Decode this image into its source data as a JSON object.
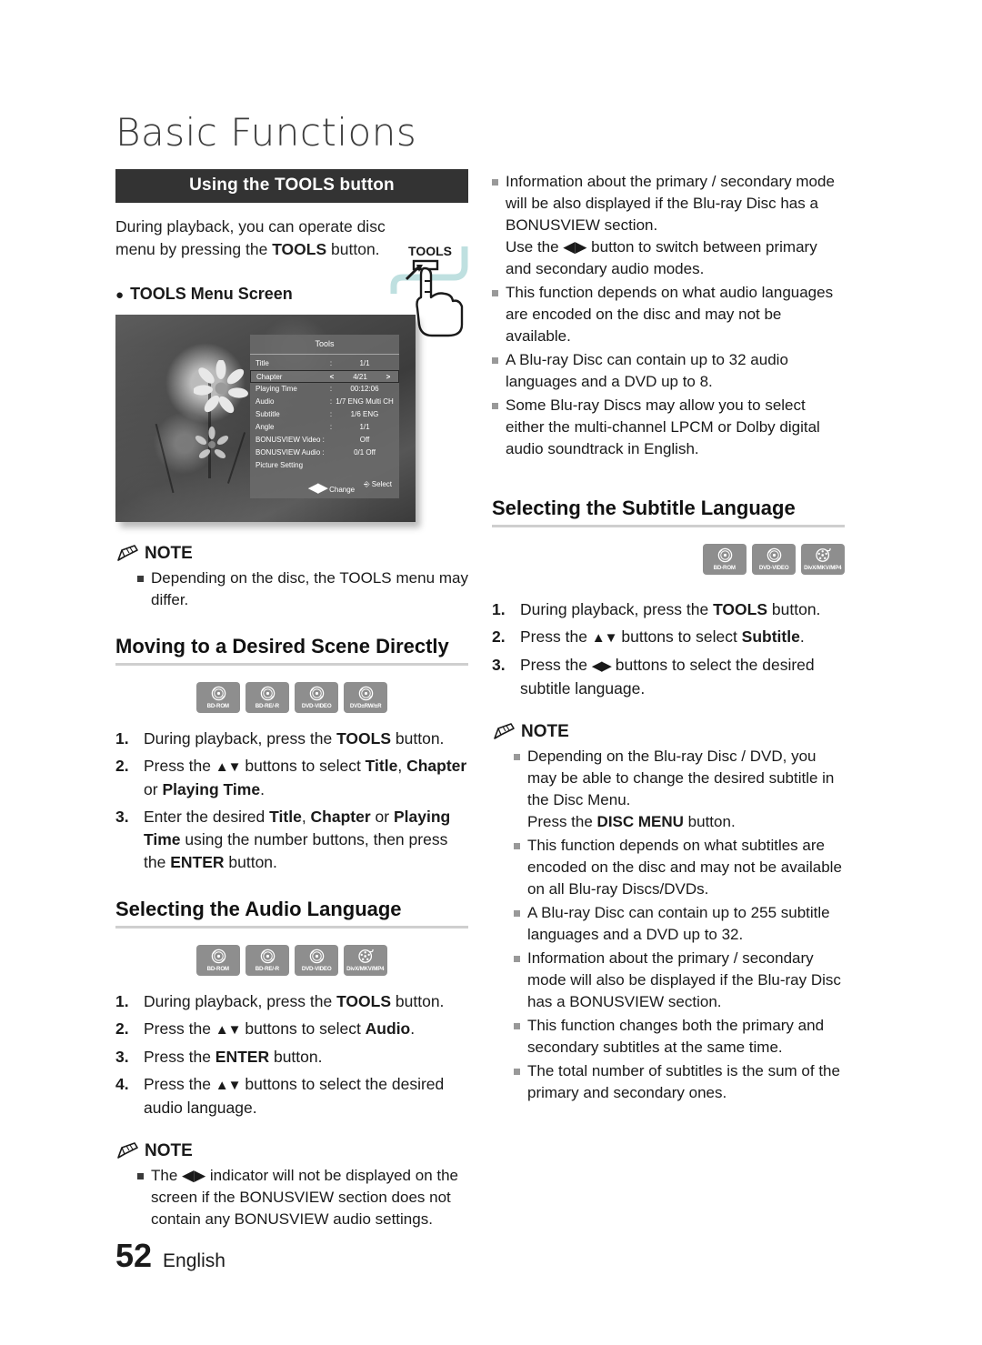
{
  "document": {
    "chapter_title": "Basic Functions",
    "page_number": "52",
    "language": "English"
  },
  "left_column": {
    "banner_label": "Using the TOOLS button",
    "intro_part1": "During playback, you can operate disc menu by pressing the ",
    "intro_bold": "TOOLS",
    "intro_part2": " button.",
    "tools_illustration_label": "TOOLS",
    "menu_screen_bullet": "TOOLS Menu Screen",
    "screenshot": {
      "osd_title": "Tools",
      "rows": [
        {
          "label": "Title",
          "sep": ":",
          "value": "1/1",
          "highlighted": false
        },
        {
          "label": "Chapter",
          "sep": "",
          "value": "4/21",
          "highlighted": true,
          "left_arrow": "<",
          "right_arrow": ">"
        },
        {
          "label": "Playing Time",
          "sep": ":",
          "value": "00:12:06",
          "highlighted": false
        },
        {
          "label": "Audio",
          "sep": ":",
          "value": "1/7 ENG Multi CH",
          "highlighted": false
        },
        {
          "label": "Subtitle",
          "sep": ":",
          "value": "1/6 ENG",
          "highlighted": false
        },
        {
          "label": "Angle",
          "sep": ":",
          "value": "1/1",
          "highlighted": false
        },
        {
          "label": "BONUSVIEW Video :",
          "sep": "",
          "value": "Off",
          "highlighted": false
        },
        {
          "label": "BONUSVIEW Audio :",
          "sep": "",
          "value": "0/1 Off",
          "highlighted": false
        },
        {
          "label": "Picture Setting",
          "sep": "",
          "value": "",
          "highlighted": false
        }
      ],
      "footer_change": "Change",
      "footer_select": "Select"
    },
    "note1": {
      "heading": "NOTE",
      "items": [
        "Depending on the disc, the TOOLS menu may differ."
      ]
    },
    "section_scene": {
      "heading": "Moving to a Desired Scene Directly",
      "discs": [
        "BD-ROM",
        "BD-RE/-R",
        "DVD-VIDEO",
        "DVD±RW/±R"
      ],
      "steps": [
        {
          "num": "1.",
          "html": "During playback, press the <b>TOOLS</b> button."
        },
        {
          "num": "2.",
          "html": "Press the <span class=\"arrows\">▲▼</span> buttons to select <b>Title</b>, <b>Chapter</b> or <b>Playing Time</b>."
        },
        {
          "num": "3.",
          "html": "Enter the desired <b>Title</b>, <b>Chapter</b> or <b>Playing Time</b> using the number buttons, then press the <b>ENTER</b> button."
        }
      ]
    },
    "section_audio": {
      "heading": "Selecting the Audio Language",
      "discs": [
        "BD-ROM",
        "BD-RE/-R",
        "DVD-VIDEO",
        "DivX/MKV/MP4"
      ],
      "steps": [
        {
          "num": "1.",
          "html": "During playback, press the <b>TOOLS</b> button."
        },
        {
          "num": "2.",
          "html": "Press the <span class=\"arrows\">▲▼</span> buttons to select <b>Audio</b>."
        },
        {
          "num": "3.",
          "html": "Press the <b>ENTER</b> button."
        },
        {
          "num": "4.",
          "html": "Press the <span class=\"arrows\">▲▼</span> buttons to select the desired audio language."
        }
      ]
    },
    "note2": {
      "heading": "NOTE",
      "items": [
        "The ◀▶ indicator will not be displayed on the screen if the BONUSVIEW section does not contain any BONUSVIEW audio settings."
      ]
    }
  },
  "right_column": {
    "audio_notes": [
      "Information about the primary / secondary mode will be also displayed if the Blu-ray Disc has a BONUSVIEW section.\nUse the ◀▶ button to switch between primary and secondary audio modes.",
      "This function depends on what audio languages are encoded on the disc and may not be available.",
      "A Blu-ray Disc can contain up to 32 audio languages and a DVD up to 8.",
      "Some Blu-ray Discs may allow you to select either the multi-channel LPCM or Dolby digital audio soundtrack in English."
    ],
    "section_subtitle": {
      "heading": "Selecting the Subtitle Language",
      "discs": [
        "BD-ROM",
        "DVD-VIDEO",
        "DivX/MKV/MP4"
      ],
      "steps": [
        {
          "num": "1.",
          "html": "During playback, press the <b>TOOLS</b> button."
        },
        {
          "num": "2.",
          "html": "Press the <span class=\"arrows\">▲▼</span> buttons to select <b>Subtitle</b>."
        },
        {
          "num": "3.",
          "html": "Press the <span class=\"arrows\">◀▶</span> buttons to select the desired subtitle language."
        }
      ]
    },
    "note3": {
      "heading": "NOTE",
      "items": [
        "Depending on the Blu-ray Disc / DVD, you may be able to change the desired subtitle in the Disc Menu.\nPress the DISC MENU button.",
        "This function depends on what subtitles are encoded on the disc and may not be available on all Blu-ray Discs/DVDs.",
        "A Blu-ray Disc can contain up to 255 subtitle languages and a DVD up to 32.",
        "Information about the primary / secondary mode will also be displayed if the Blu-ray Disc has a BONUSVIEW section.",
        "This function changes both the primary and secondary subtitles at the same time.",
        "The total number of subtitles is the sum of the primary and secondary ones."
      ]
    }
  },
  "icons": {
    "note": "pencil-icon",
    "disc": "disc-icon",
    "film": "film-reel-icon",
    "hand": "hand-pressing-icon"
  },
  "colors": {
    "banner_bg": "#333333",
    "disc_badge": "#8e8e8e",
    "heading_rule": "#cfcfcf"
  }
}
